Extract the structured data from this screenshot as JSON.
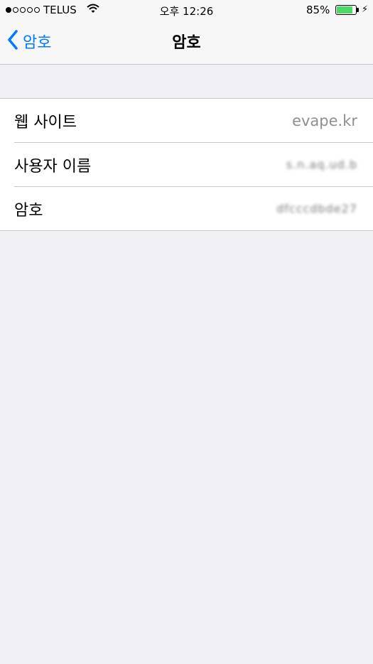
{
  "status_bar": {
    "carrier": "TELUS",
    "time": "오후 12:26",
    "battery": "85%",
    "battery_level": 0.85,
    "signal_bars": 1
  },
  "nav": {
    "back_label": "암호",
    "title": "암호"
  },
  "rows": [
    {
      "label": "웹 사이트",
      "value": "evape.kr"
    },
    {
      "label": "사용자 이름",
      "value": "s.n.aq.ud.b"
    },
    {
      "label": "암호",
      "value": "dfcccdbde27"
    }
  ],
  "colors": {
    "accent": "#007aff",
    "background": "#efeff4",
    "battery": "#4cd964"
  }
}
